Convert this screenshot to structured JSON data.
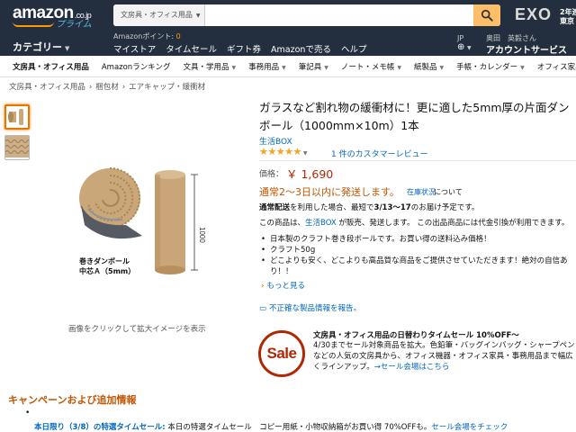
{
  "header": {
    "logo_text": "amazon",
    "logo_suffix": ".co.jp",
    "logo_sub": "プライム",
    "search_category": "文房具・オフィス用品",
    "search_placeholder": "",
    "promo_logo": "EXO",
    "promo_line1": "2年連続",
    "promo_line2": "東京ドー",
    "category_menu": "カテゴリー",
    "points_label": "Amazonポイント:",
    "points_value": "0",
    "nav_links": [
      "マイストア",
      "タイムセール",
      "ギフト券",
      "Amazonで売る",
      "ヘルプ"
    ],
    "lang": "JP",
    "greeting": "奥田　英毅さん",
    "account_label": "アカウントサービス"
  },
  "subnav": {
    "items": [
      "文房具・オフィス用品",
      "Amazonランキング",
      "文具・学用品",
      "事務用品",
      "筆記具",
      "ノート・メモ帳",
      "紙製品",
      "手帳・カレンダー",
      "オフィス家具"
    ]
  },
  "breadcrumb": [
    "文房具・オフィス用品",
    "梱包材",
    "エアキャップ・緩衝材"
  ],
  "image": {
    "caption_line1": "巻きダンボール",
    "caption_line2": "中芯Ａ（5mm）",
    "dimension_label": "1000",
    "hint": "画像をクリックして拡大イメージを表示"
  },
  "product": {
    "title": "ガラスなど割れ物の緩衝材に！更に適した5mm厚の片面ダンボール（1000mm×10m）1本",
    "brand": "生活BOX",
    "rating_stars": "★★★★★",
    "reviews": "1 件のカスタマーレビュー",
    "price_label": "価格：",
    "price": "￥ 1,690",
    "availability": "通常2～3日以内に発送します。",
    "availability_link": "在庫状況",
    "availability_tail": "について",
    "delivery_bold1": "通常配送",
    "delivery_mid": "を利用した場合、最短で",
    "delivery_bold2": "3/13～17",
    "delivery_tail": "のお届け予定です。",
    "sold_by_pre": "この商品は、",
    "sold_by_link": "生活BOX",
    "sold_by_tail": " が販売、発送します。 この出品商品には代金引換が利用できます。",
    "bullets": [
      "日本製のクラフト巻き段ボールです。お買い得の送料込み価格！",
      "クラフト50g",
      "どこよりも安く、どこよりも高品質な商品をご提供させていただきます！絶対の自信あり！！"
    ],
    "more_link": "もっと見る",
    "report_link": "不正確な製品情報を報告。"
  },
  "sale": {
    "badge": "Sale",
    "title": "文房具・オフィス用品の日替わりタイムセール 10%OFF～",
    "desc": "4/30までセール対象商品を拡大。色鉛筆・バッグインバッグ・シャープペンなどの人気の文房具から、オフィス機器・オフィス家具・事務用品まで幅広くラインアップ。",
    "link": "→セール会場はこちら"
  },
  "campaign": {
    "heading": "キャンペーンおよび追加情報",
    "bullet": "•",
    "highlight": "本日限り（3/8）の特選タイムセール:",
    "text": " 本日の特選タイムセール　コピー用紙・小物収納箱がお買い得 70%OFFも。",
    "link": "セール会場をチェック"
  },
  "colors": {
    "header_bg": "#232f3e",
    "price": "#b12704",
    "link": "#0066c0",
    "availability": "#c45500",
    "search_button": "#febd69"
  }
}
